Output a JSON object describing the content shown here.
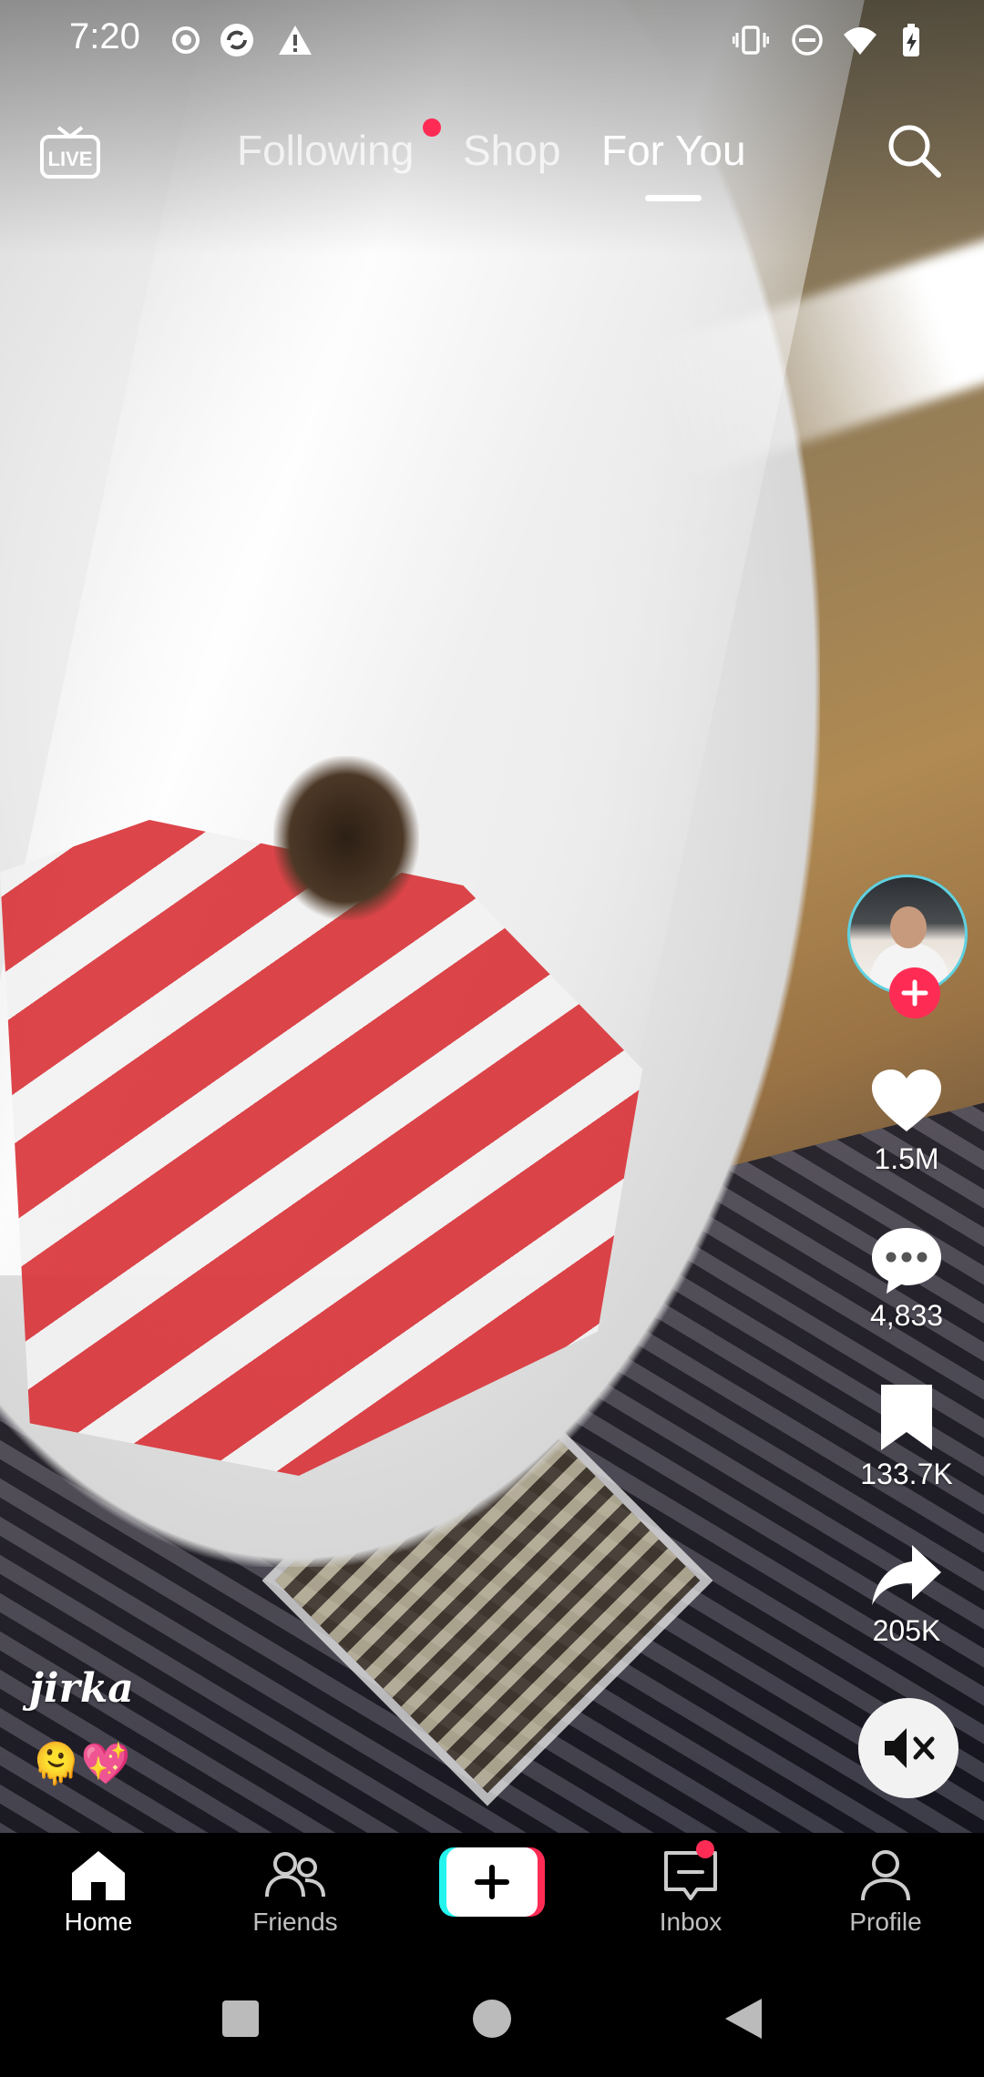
{
  "status_bar": {
    "time": "7:20",
    "left_icons": [
      "record-icon",
      "sync-icon",
      "warning-icon"
    ],
    "right_icons": [
      "vibrate-icon",
      "do-not-disturb-icon",
      "wifi-icon",
      "battery-charging-icon"
    ]
  },
  "top_nav": {
    "live_icon": "live-tv-icon",
    "tabs": [
      {
        "label": "Following",
        "active": false,
        "has_dot": true
      },
      {
        "label": "Shop",
        "active": false
      },
      {
        "label": "For You",
        "active": true
      }
    ],
    "search_icon": "search-icon"
  },
  "creator": {
    "username": "jirka",
    "caption_emojis": "🫠💖"
  },
  "actions": {
    "likes": "1.5M",
    "comments": "4,833",
    "bookmarks": "133.7K",
    "shares": "205K",
    "follow_icon": "plus-icon",
    "mute_icon": "speaker-muted-icon"
  },
  "bottom_nav": {
    "items": [
      {
        "label": "Home",
        "icon": "home-icon",
        "active": true
      },
      {
        "label": "Friends",
        "icon": "friends-icon",
        "active": false
      },
      {
        "label": "",
        "icon": "create-plus-icon",
        "active": false
      },
      {
        "label": "Inbox",
        "icon": "inbox-icon",
        "active": false,
        "has_dot": true
      },
      {
        "label": "Profile",
        "icon": "profile-icon",
        "active": false
      }
    ]
  },
  "system_nav": [
    "recents-square-icon",
    "home-circle-icon",
    "back-triangle-icon"
  ],
  "colors": {
    "accent": "#fe2c55",
    "cyan": "#25f4ee",
    "avatar_ring": "#5fd1e0"
  }
}
